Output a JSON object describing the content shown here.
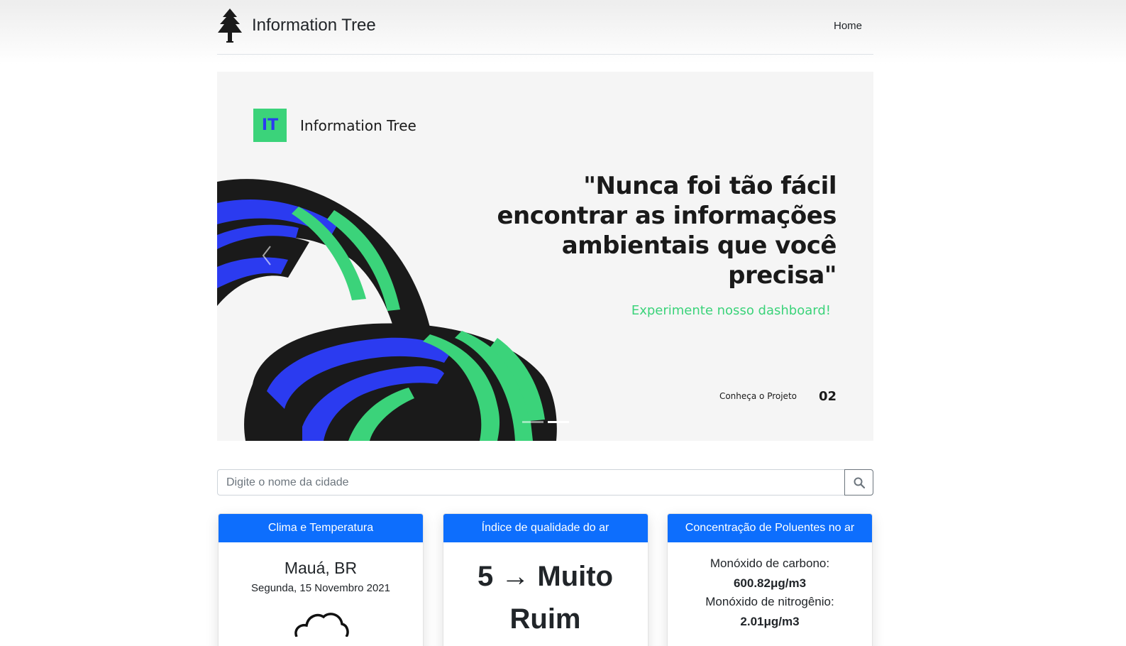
{
  "header": {
    "brand": "Information Tree",
    "nav": {
      "home": "Home"
    }
  },
  "hero": {
    "logo_badge": "IT",
    "logo_text": "Information Tree",
    "quote": "\"Nunca foi tão fácil encontrar as informações ambientais que você precisa\"",
    "cta": "Experimente nosso dashboard!",
    "more": "Conheça o Projeto",
    "slide_number": "02",
    "colors": {
      "green": "#3bd37a",
      "blue": "#2b3bf0",
      "dark": "#1a1a1a"
    }
  },
  "search": {
    "placeholder": "Digite o nome da cidade",
    "button_icon": "search-icon"
  },
  "cards": {
    "weather": {
      "title": "Clima e Temperatura",
      "city": "Mauá, BR",
      "date": "Segunda, 15 Novembro 2021",
      "icon": "cloud-icon"
    },
    "air_quality": {
      "title": "Índice de qualidade do ar",
      "index_line1": "5 → Muito",
      "index_line2": "Ruim"
    },
    "pollutants": {
      "title": "Concentração de Poluentes no ar",
      "items": [
        {
          "label": "Monóxido de carbono:",
          "value": "600.82μg/m3"
        },
        {
          "label": "Monóxido de nitrogênio:",
          "value": "2.01μg/m3"
        }
      ]
    }
  },
  "accent_color": "#0d6efd"
}
